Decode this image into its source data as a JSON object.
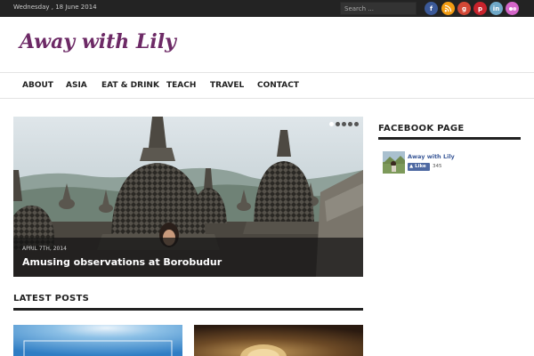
{
  "topbar": {
    "date": "Wednesday , 18 June 2014",
    "search_placeholder": "Search ...",
    "social": [
      {
        "icon": "facebook-icon",
        "glyph": "f",
        "color": "#3b5998"
      },
      {
        "icon": "rss-icon",
        "glyph": "◔",
        "color": "#f39c12"
      },
      {
        "icon": "google-plus-icon",
        "glyph": "g",
        "color": "#d34836"
      },
      {
        "icon": "pinterest-icon",
        "glyph": "p",
        "color": "#c8232c"
      },
      {
        "icon": "linkedin-icon",
        "glyph": "in",
        "color": "#6fa8c8"
      },
      {
        "icon": "flickr-icon",
        "glyph": "••",
        "color": "#d466c9"
      }
    ]
  },
  "header": {
    "logo": "Away with Lily"
  },
  "nav": {
    "items": [
      {
        "label": "ABOUT"
      },
      {
        "label": "ASIA"
      },
      {
        "label": "EAT & DRINK"
      },
      {
        "label": "TEACH"
      },
      {
        "label": "TRAVEL"
      },
      {
        "label": "CONTACT"
      }
    ]
  },
  "slider": {
    "date": "APRIL 7TH, 2014",
    "title": "Amusing observations at Borobudur",
    "active_dot": 1,
    "dot_count": 5
  },
  "latest": {
    "title": "LATEST POSTS"
  },
  "sidebar": {
    "facebook_title": "FACEBOOK PAGE",
    "page_name": "Away with Lily",
    "like_label": "Like",
    "like_count": "345"
  },
  "colors": {
    "brand": "#6d2a66",
    "topbar": "#232323",
    "facebook": "#3b5998"
  }
}
